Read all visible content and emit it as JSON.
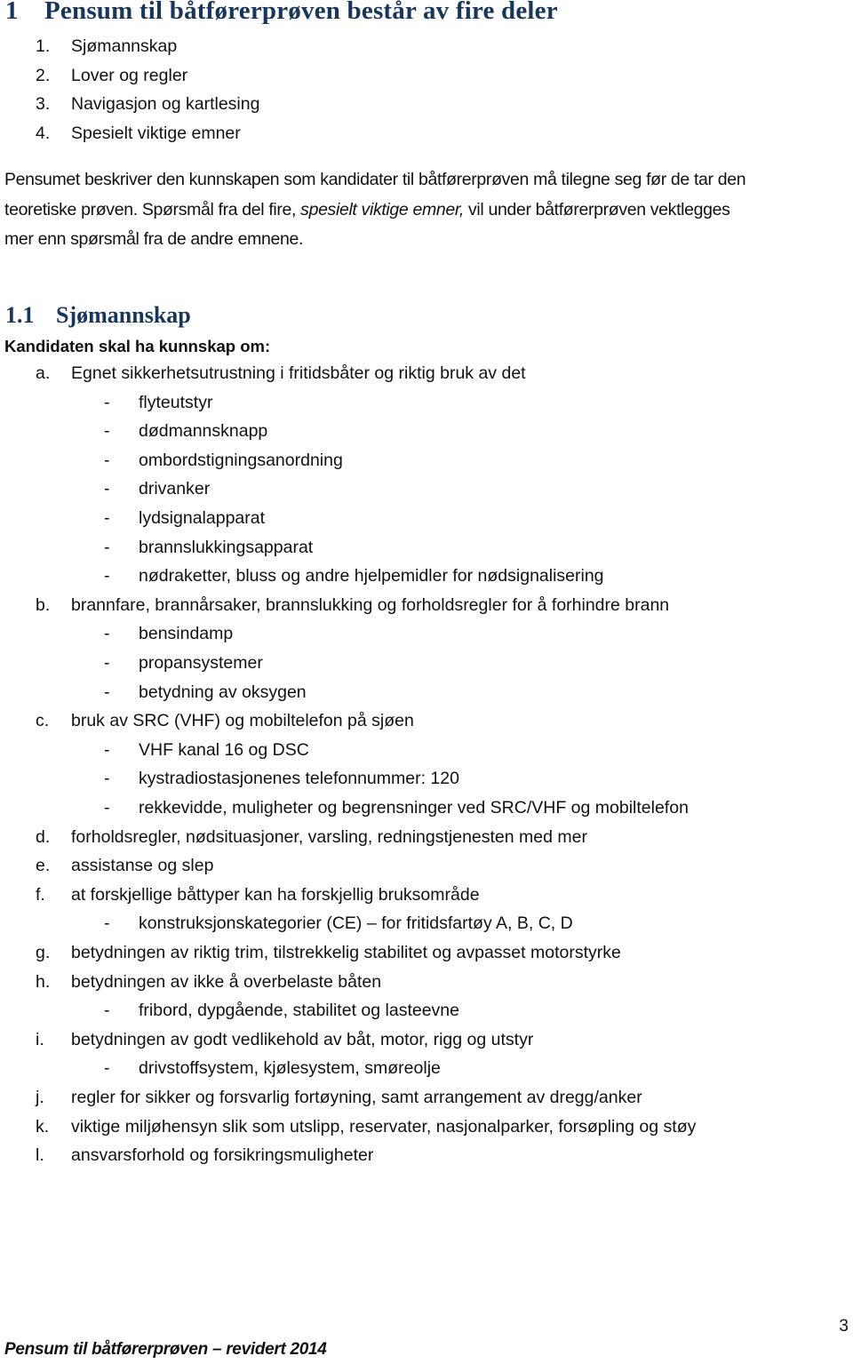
{
  "heading1": {
    "number": "1",
    "title": "Pensum til båtførerprøven består av fire deler"
  },
  "parts": [
    {
      "num": "1.",
      "text": "Sjømannskap"
    },
    {
      "num": "2.",
      "text": "Lover og regler"
    },
    {
      "num": "3.",
      "text": "Navigasjon og kartlesing"
    },
    {
      "num": "4.",
      "text": "Spesielt viktige emner"
    }
  ],
  "intro": {
    "line1": "Pensumet beskriver den kunnskapen som kandidater til båtførerprøven må tilegne seg før de tar den",
    "line2_pre": "teoretiske prøven. Spørsmål fra del fire, ",
    "line2_em": "spesielt viktige emner,",
    "line2_post": " vil under båtførerprøven vektlegges",
    "line3": "mer enn spørsmål fra de andre emnene."
  },
  "heading2": {
    "number": "1.1",
    "title": "Sjømannskap"
  },
  "subheading": "Kandidaten skal ha kunnskap om:",
  "items": [
    {
      "letter": "a.",
      "text": "Egnet sikkerhetsutrustning i fritidsbåter og riktig bruk av det",
      "subs": [
        "flyteutstyr",
        "dødmannsknapp",
        "ombordstigningsanordning",
        "drivanker",
        "lydsignalapparat",
        "brannslukkingsapparat",
        "nødraketter, bluss og andre hjelpemidler for nødsignalisering"
      ]
    },
    {
      "letter": "b.",
      "text": "brannfare, brannårsaker, brannslukking og forholdsregler for å forhindre brann",
      "subs": [
        "bensindamp",
        "propansystemer",
        "betydning av oksygen"
      ]
    },
    {
      "letter": "c.",
      "text": "bruk av SRC (VHF) og mobiltelefon på sjøen",
      "subs": [
        "VHF kanal 16 og DSC",
        "kystradiostasjonenes telefonnummer: 120",
        "rekkevidde, muligheter og begrensninger ved SRC/VHF og mobiltelefon"
      ]
    },
    {
      "letter": "d.",
      "text": "forholdsregler, nødsituasjoner, varsling, redningstjenesten med mer",
      "subs": []
    },
    {
      "letter": "e.",
      "text": "assistanse og slep",
      "subs": []
    },
    {
      "letter": "f.",
      "text": "at forskjellige båttyper kan ha forskjellig bruksområde",
      "subs": [
        "konstruksjonskategorier (CE) – for fritidsfartøy A, B, C, D"
      ]
    },
    {
      "letter": "g.",
      "text": "betydningen av riktig trim, tilstrekkelig stabilitet og avpasset motorstyrke",
      "subs": []
    },
    {
      "letter": "h.",
      "text": "betydningen av ikke å overbelaste båten",
      "subs": [
        "fribord, dypgående, stabilitet og lasteevne"
      ]
    },
    {
      "letter": "i.",
      "text": "betydningen av godt vedlikehold av båt, motor, rigg og utstyr",
      "subs": [
        "drivstoffsystem, kjølesystem, smøreolje"
      ]
    },
    {
      "letter": "j.",
      "text": "regler for sikker og forsvarlig fortøyning, samt arrangement av dregg/anker",
      "subs": []
    },
    {
      "letter": "k.",
      "text": "viktige miljøhensyn slik som utslipp, reservater, nasjonalparker, forsøpling og støy",
      "subs": []
    },
    {
      "letter": "l.",
      "text": "ansvarsforhold og forsikringsmuligheter",
      "subs": []
    }
  ],
  "dash": "-",
  "footer": {
    "text": "Pensum til båtførerprøven – revidert 2014",
    "page_number": "3"
  }
}
